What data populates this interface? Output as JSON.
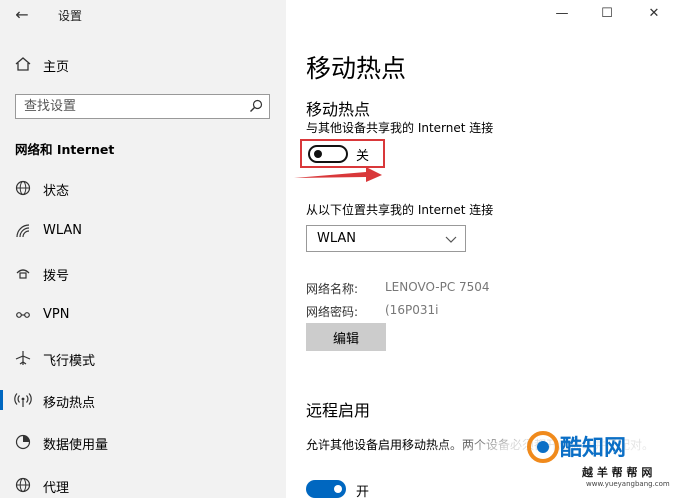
{
  "window": {
    "title": "设置",
    "back": "←",
    "minimize": "—",
    "maximize": "☐",
    "close": "✕"
  },
  "sidebar": {
    "home_label": "主页",
    "search_placeholder": "查找设置",
    "section_title": "网络和 Internet",
    "items": [
      {
        "label": "状态",
        "icon": "globe-icon"
      },
      {
        "label": "WLAN",
        "icon": "wifi-icon"
      },
      {
        "label": "拨号",
        "icon": "dialup-icon"
      },
      {
        "label": "VPN",
        "icon": "vpn-icon"
      },
      {
        "label": "飞行模式",
        "icon": "airplane-icon"
      },
      {
        "label": "移动热点",
        "icon": "hotspot-icon",
        "active": true
      },
      {
        "label": "数据使用量",
        "icon": "data-usage-icon"
      },
      {
        "label": "代理",
        "icon": "globe-icon"
      }
    ]
  },
  "main": {
    "page_title": "移动热点",
    "hotspot": {
      "title": "移动热点",
      "description": "与其他设备共享我的 Internet 连接",
      "toggle_state": "关"
    },
    "share_from": {
      "label": "从以下位置共享我的 Internet 连接",
      "selected": "WLAN"
    },
    "network_name_label": "网络名称:",
    "network_name_value": "LENOVO-PC 7504",
    "network_password_label": "网络密码:",
    "network_password_value": "(16P031i",
    "edit_button": "编辑",
    "remote": {
      "title": "远程启用",
      "description": "允许其他设备启用移动热点。两个设备必须都开启蓝牙并已配对。",
      "toggle_state": "开"
    }
  },
  "watermark": {
    "name": "酷知网",
    "sub": "越 羊 帮 帮 网",
    "url": "www.yueyangbang.com"
  },
  "colors": {
    "accent": "#0067c0",
    "highlight": "#d9383a",
    "sidebar_bg": "#f2f2f2"
  }
}
